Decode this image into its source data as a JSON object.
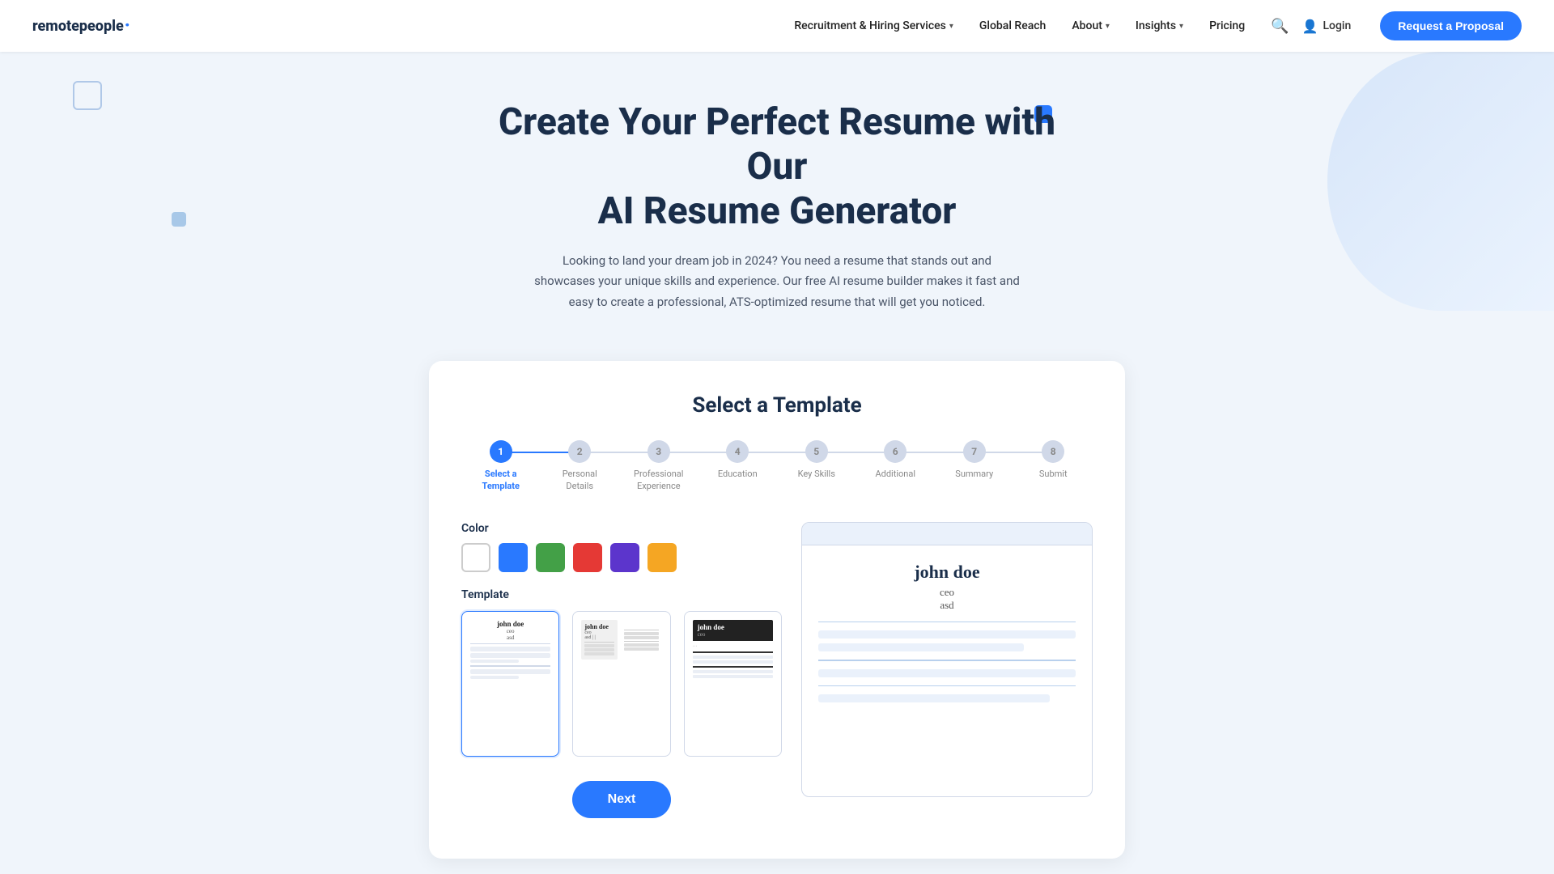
{
  "nav": {
    "logo": {
      "text": "remote people",
      "remote": "remote",
      "people": "people",
      "dot": "·"
    },
    "links": [
      {
        "label": "Recruitment & Hiring Services",
        "hasDropdown": true
      },
      {
        "label": "Global Reach",
        "hasDropdown": false
      },
      {
        "label": "About",
        "hasDropdown": true
      },
      {
        "label": "Insights",
        "hasDropdown": true
      },
      {
        "label": "Pricing",
        "hasDropdown": false
      }
    ],
    "login_label": "Login",
    "cta_label": "Request a Proposal"
  },
  "hero": {
    "title_line1": "Create Your Perfect Resume with Our",
    "title_line2": "AI Resume Generator",
    "description": "Looking to land your dream job in 2024? You need a resume that stands out and showcases your unique skills and experience. Our free AI resume builder makes it fast and easy to create a professional, ATS-optimized resume that will get you noticed."
  },
  "card": {
    "title": "Select a Template",
    "steps": [
      {
        "number": "1",
        "label": "Select a\nTemplate",
        "active": true
      },
      {
        "number": "2",
        "label": "Personal\nDetails",
        "active": false
      },
      {
        "number": "3",
        "label": "Professional\nExperience",
        "active": false
      },
      {
        "number": "4",
        "label": "Education",
        "active": false
      },
      {
        "number": "5",
        "label": "Key Skills",
        "active": false
      },
      {
        "number": "6",
        "label": "Additional",
        "active": false
      },
      {
        "number": "7",
        "label": "Summary",
        "active": false
      },
      {
        "number": "8",
        "label": "Submit",
        "active": false
      }
    ],
    "color_label": "Color",
    "colors": [
      {
        "id": "white",
        "label": "White",
        "selected": true
      },
      {
        "id": "blue",
        "label": "Blue"
      },
      {
        "id": "green",
        "label": "Green"
      },
      {
        "id": "red",
        "label": "Red"
      },
      {
        "id": "purple",
        "label": "Purple"
      },
      {
        "id": "orange",
        "label": "Orange"
      }
    ],
    "template_label": "Template",
    "templates": [
      {
        "id": "t1",
        "name": "john doe",
        "title": "ceo",
        "sub": "asd",
        "selected": true
      },
      {
        "id": "t2",
        "name": "john doe",
        "title": "ceo",
        "sub": "asd | |",
        "selected": false
      },
      {
        "id": "t3",
        "name": "john doe",
        "title": "ceo",
        "sub": "",
        "selected": false
      }
    ],
    "preview": {
      "name": "john doe",
      "title": "ceo",
      "sub": "asd"
    },
    "next_button": "Next"
  }
}
